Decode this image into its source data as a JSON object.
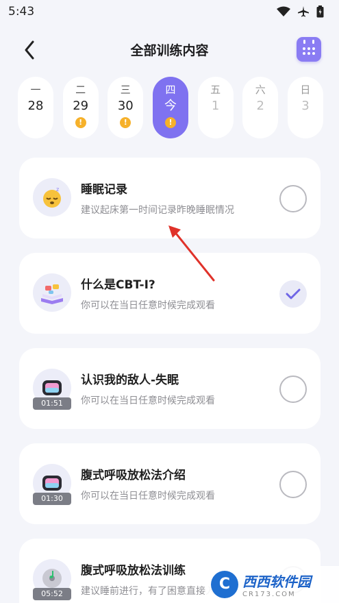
{
  "status_bar": {
    "time": "5:43"
  },
  "header": {
    "title": "全部训练内容"
  },
  "week": [
    {
      "weekday": "一",
      "date": "28",
      "state": "past",
      "warning": false
    },
    {
      "weekday": "二",
      "date": "29",
      "state": "past",
      "warning": true
    },
    {
      "weekday": "三",
      "date": "30",
      "state": "past",
      "warning": true
    },
    {
      "weekday": "四",
      "date": "今",
      "state": "selected",
      "warning": true
    },
    {
      "weekday": "五",
      "date": "1",
      "state": "future",
      "warning": false
    },
    {
      "weekday": "六",
      "date": "2",
      "state": "future",
      "warning": false
    },
    {
      "weekday": "日",
      "date": "3",
      "state": "future",
      "warning": false
    }
  ],
  "tasks": [
    {
      "title": "睡眠记录",
      "subtitle": "建议起床第一时间记录昨晚睡眠情况",
      "icon": "sleepy-face-icon",
      "completed": false
    },
    {
      "title": "什么是CBT-I?",
      "subtitle": "你可以在当日任意时候完成观看",
      "icon": "open-book-icon",
      "completed": true
    },
    {
      "title": "认识我的敌人-失眠",
      "subtitle": "你可以在当日任意时候完成观看",
      "icon": "video-tv-icon",
      "duration": "01:51",
      "completed": false
    },
    {
      "title": "腹式呼吸放松法介绍",
      "subtitle": "你可以在当日任意时候完成观看",
      "icon": "video-tv-icon",
      "duration": "01:30",
      "completed": false
    },
    {
      "title": "腹式呼吸放松法训练",
      "subtitle": "建议睡前进行，有了困意直接入睡",
      "icon": "music-disc-icon",
      "duration": "05:52",
      "completed": false
    }
  ],
  "watermark": {
    "name": "西西软件园",
    "domain": "CR173.COM",
    "logo_letter": "C"
  },
  "colors": {
    "accent": "#7f72f0",
    "warning": "#f6b12a",
    "background": "#f4f5fa"
  }
}
